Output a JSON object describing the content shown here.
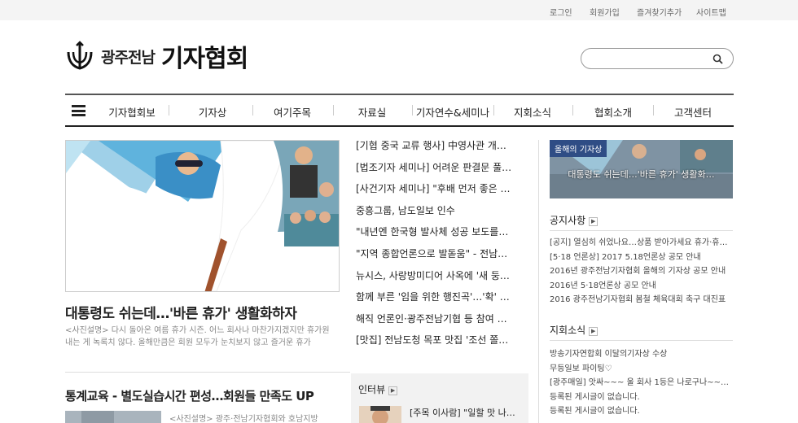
{
  "topbar": {
    "links": [
      "로그인",
      "회원가입",
      "즐겨찾기추가",
      "사이트맵"
    ]
  },
  "logo": {
    "small_text": "광주전남",
    "big_text": "기자협회"
  },
  "search": {
    "placeholder": ""
  },
  "nav": {
    "items": [
      "기자협회보",
      "기자상",
      "여기주목",
      "자료실",
      "기자연수&세미나",
      "지회소식",
      "협회소개",
      "고객센터"
    ]
  },
  "main_story": {
    "headline": "대통령도 쉬는데…'바른 휴가' 생활화하자",
    "description": "<사진설명> 다시 돌아온 여름 휴가 시즌. 어느 회사나 마찬가지겠지만 휴가원 내는 게 녹록치 않다. 올해만큼은 회원 모두가 눈치보지 않고 즐거운 휴가"
  },
  "news_list": [
    "[기협 중국 교류 행사] 中영사관 개…",
    "[법조기자 세미나] 어려운 판결문 풀…",
    "[사건기자 세미나] \"후배 먼저 좋은 …",
    "중흥그룹, 남도일보 인수",
    "\"내년엔 한국형 발사체 성공 보도를…",
    "\"지역 종합언론으로 발돋움\" - 전남…",
    "뉴시스, 사랑방미디어 사옥에 '새 둥…",
    "함께 부른 '임을 위한 행진곡'…'확' …",
    "해직 언론인·광주전남기협 등 참여 …",
    "[맛집] 전남도청 목포 맛집 '조선 쫄…"
  ],
  "banner": {
    "tag": "올해의 기자상",
    "caption": "대통령도 쉬는데…'바른 휴가' 생활화…"
  },
  "notice": {
    "title": "공지사항",
    "items": [
      "[공지] 열심히 쉬었나요…상품 받아가세요 휴가·휴…",
      "[5·18 언론상] 2017 5.18언론상 공모 안내",
      "2016년 광주전남기자협회 올해의 기자상 공모 안내",
      "2016년 5·18언론상 공모 안내",
      "2016 광주전남기자협회 봄철 체육대회 축구 대진표"
    ]
  },
  "branch_news": {
    "title": "지회소식",
    "items": [
      "방송기자연합회 이달의기자상 수상",
      "무등일보 파이팅♡",
      "[광주매일] 앗싸~~~ 울 회사 1등은 나로구나~~~(…",
      "등록된 게시글이 없습니다.",
      "등록된 게시글이 없습니다."
    ]
  },
  "bottom_story": {
    "headline": "통계교육 - 별도실습시간 편성…회원들 만족도 UP",
    "description": "<사진설명> 광주·전남기자협회와 호남지방"
  },
  "interview": {
    "title": "인터뷰",
    "item": "[주목 이사람] \"일할 맛 나…"
  }
}
